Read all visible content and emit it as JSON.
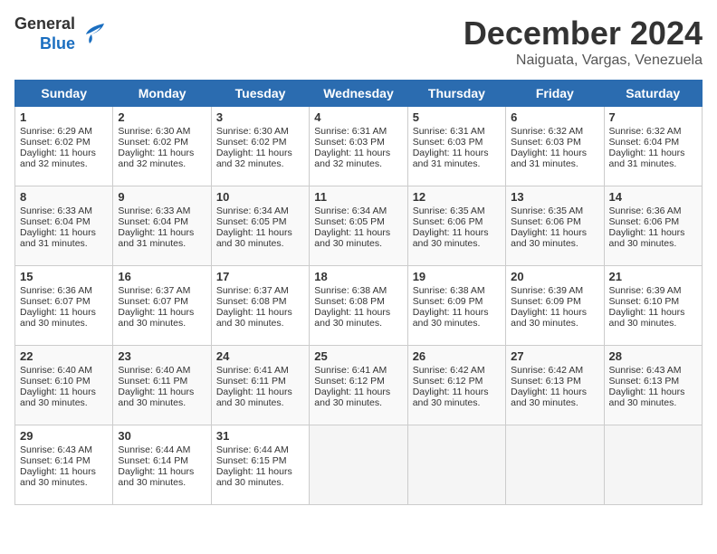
{
  "logo": {
    "line1": "General",
    "line2": "Blue"
  },
  "title": "December 2024",
  "location": "Naiguata, Vargas, Venezuela",
  "headers": [
    "Sunday",
    "Monday",
    "Tuesday",
    "Wednesday",
    "Thursday",
    "Friday",
    "Saturday"
  ],
  "weeks": [
    [
      {
        "day": "1",
        "sunrise": "6:29 AM",
        "sunset": "6:02 PM",
        "daylight": "11 hours and 32 minutes."
      },
      {
        "day": "2",
        "sunrise": "6:30 AM",
        "sunset": "6:02 PM",
        "daylight": "11 hours and 32 minutes."
      },
      {
        "day": "3",
        "sunrise": "6:30 AM",
        "sunset": "6:02 PM",
        "daylight": "11 hours and 32 minutes."
      },
      {
        "day": "4",
        "sunrise": "6:31 AM",
        "sunset": "6:03 PM",
        "daylight": "11 hours and 32 minutes."
      },
      {
        "day": "5",
        "sunrise": "6:31 AM",
        "sunset": "6:03 PM",
        "daylight": "11 hours and 31 minutes."
      },
      {
        "day": "6",
        "sunrise": "6:32 AM",
        "sunset": "6:03 PM",
        "daylight": "11 hours and 31 minutes."
      },
      {
        "day": "7",
        "sunrise": "6:32 AM",
        "sunset": "6:04 PM",
        "daylight": "11 hours and 31 minutes."
      }
    ],
    [
      {
        "day": "8",
        "sunrise": "6:33 AM",
        "sunset": "6:04 PM",
        "daylight": "11 hours and 31 minutes."
      },
      {
        "day": "9",
        "sunrise": "6:33 AM",
        "sunset": "6:04 PM",
        "daylight": "11 hours and 31 minutes."
      },
      {
        "day": "10",
        "sunrise": "6:34 AM",
        "sunset": "6:05 PM",
        "daylight": "11 hours and 30 minutes."
      },
      {
        "day": "11",
        "sunrise": "6:34 AM",
        "sunset": "6:05 PM",
        "daylight": "11 hours and 30 minutes."
      },
      {
        "day": "12",
        "sunrise": "6:35 AM",
        "sunset": "6:06 PM",
        "daylight": "11 hours and 30 minutes."
      },
      {
        "day": "13",
        "sunrise": "6:35 AM",
        "sunset": "6:06 PM",
        "daylight": "11 hours and 30 minutes."
      },
      {
        "day": "14",
        "sunrise": "6:36 AM",
        "sunset": "6:06 PM",
        "daylight": "11 hours and 30 minutes."
      }
    ],
    [
      {
        "day": "15",
        "sunrise": "6:36 AM",
        "sunset": "6:07 PM",
        "daylight": "11 hours and 30 minutes."
      },
      {
        "day": "16",
        "sunrise": "6:37 AM",
        "sunset": "6:07 PM",
        "daylight": "11 hours and 30 minutes."
      },
      {
        "day": "17",
        "sunrise": "6:37 AM",
        "sunset": "6:08 PM",
        "daylight": "11 hours and 30 minutes."
      },
      {
        "day": "18",
        "sunrise": "6:38 AM",
        "sunset": "6:08 PM",
        "daylight": "11 hours and 30 minutes."
      },
      {
        "day": "19",
        "sunrise": "6:38 AM",
        "sunset": "6:09 PM",
        "daylight": "11 hours and 30 minutes."
      },
      {
        "day": "20",
        "sunrise": "6:39 AM",
        "sunset": "6:09 PM",
        "daylight": "11 hours and 30 minutes."
      },
      {
        "day": "21",
        "sunrise": "6:39 AM",
        "sunset": "6:10 PM",
        "daylight": "11 hours and 30 minutes."
      }
    ],
    [
      {
        "day": "22",
        "sunrise": "6:40 AM",
        "sunset": "6:10 PM",
        "daylight": "11 hours and 30 minutes."
      },
      {
        "day": "23",
        "sunrise": "6:40 AM",
        "sunset": "6:11 PM",
        "daylight": "11 hours and 30 minutes."
      },
      {
        "day": "24",
        "sunrise": "6:41 AM",
        "sunset": "6:11 PM",
        "daylight": "11 hours and 30 minutes."
      },
      {
        "day": "25",
        "sunrise": "6:41 AM",
        "sunset": "6:12 PM",
        "daylight": "11 hours and 30 minutes."
      },
      {
        "day": "26",
        "sunrise": "6:42 AM",
        "sunset": "6:12 PM",
        "daylight": "11 hours and 30 minutes."
      },
      {
        "day": "27",
        "sunrise": "6:42 AM",
        "sunset": "6:13 PM",
        "daylight": "11 hours and 30 minutes."
      },
      {
        "day": "28",
        "sunrise": "6:43 AM",
        "sunset": "6:13 PM",
        "daylight": "11 hours and 30 minutes."
      }
    ],
    [
      {
        "day": "29",
        "sunrise": "6:43 AM",
        "sunset": "6:14 PM",
        "daylight": "11 hours and 30 minutes."
      },
      {
        "day": "30",
        "sunrise": "6:44 AM",
        "sunset": "6:14 PM",
        "daylight": "11 hours and 30 minutes."
      },
      {
        "day": "31",
        "sunrise": "6:44 AM",
        "sunset": "6:15 PM",
        "daylight": "11 hours and 30 minutes."
      },
      null,
      null,
      null,
      null
    ]
  ]
}
